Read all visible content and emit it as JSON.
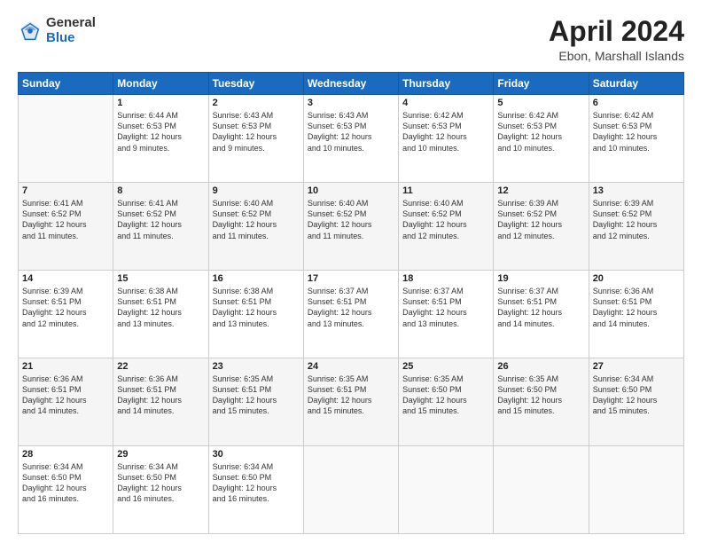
{
  "header": {
    "logo_general": "General",
    "logo_blue": "Blue",
    "month_year": "April 2024",
    "location": "Ebon, Marshall Islands"
  },
  "days_of_week": [
    "Sunday",
    "Monday",
    "Tuesday",
    "Wednesday",
    "Thursday",
    "Friday",
    "Saturday"
  ],
  "weeks": [
    [
      {
        "day": "",
        "sunrise": "",
        "sunset": "",
        "daylight": ""
      },
      {
        "day": "1",
        "sunrise": "6:44 AM",
        "sunset": "6:53 PM",
        "daylight": "12 hours and 9 minutes."
      },
      {
        "day": "2",
        "sunrise": "6:43 AM",
        "sunset": "6:53 PM",
        "daylight": "12 hours and 9 minutes."
      },
      {
        "day": "3",
        "sunrise": "6:43 AM",
        "sunset": "6:53 PM",
        "daylight": "12 hours and 10 minutes."
      },
      {
        "day": "4",
        "sunrise": "6:42 AM",
        "sunset": "6:53 PM",
        "daylight": "12 hours and 10 minutes."
      },
      {
        "day": "5",
        "sunrise": "6:42 AM",
        "sunset": "6:53 PM",
        "daylight": "12 hours and 10 minutes."
      },
      {
        "day": "6",
        "sunrise": "6:42 AM",
        "sunset": "6:53 PM",
        "daylight": "12 hours and 10 minutes."
      }
    ],
    [
      {
        "day": "7",
        "sunrise": "6:41 AM",
        "sunset": "6:52 PM",
        "daylight": "12 hours and 11 minutes."
      },
      {
        "day": "8",
        "sunrise": "6:41 AM",
        "sunset": "6:52 PM",
        "daylight": "12 hours and 11 minutes."
      },
      {
        "day": "9",
        "sunrise": "6:40 AM",
        "sunset": "6:52 PM",
        "daylight": "12 hours and 11 minutes."
      },
      {
        "day": "10",
        "sunrise": "6:40 AM",
        "sunset": "6:52 PM",
        "daylight": "12 hours and 11 minutes."
      },
      {
        "day": "11",
        "sunrise": "6:40 AM",
        "sunset": "6:52 PM",
        "daylight": "12 hours and 12 minutes."
      },
      {
        "day": "12",
        "sunrise": "6:39 AM",
        "sunset": "6:52 PM",
        "daylight": "12 hours and 12 minutes."
      },
      {
        "day": "13",
        "sunrise": "6:39 AM",
        "sunset": "6:52 PM",
        "daylight": "12 hours and 12 minutes."
      }
    ],
    [
      {
        "day": "14",
        "sunrise": "6:39 AM",
        "sunset": "6:51 PM",
        "daylight": "12 hours and 12 minutes."
      },
      {
        "day": "15",
        "sunrise": "6:38 AM",
        "sunset": "6:51 PM",
        "daylight": "12 hours and 13 minutes."
      },
      {
        "day": "16",
        "sunrise": "6:38 AM",
        "sunset": "6:51 PM",
        "daylight": "12 hours and 13 minutes."
      },
      {
        "day": "17",
        "sunrise": "6:37 AM",
        "sunset": "6:51 PM",
        "daylight": "12 hours and 13 minutes."
      },
      {
        "day": "18",
        "sunrise": "6:37 AM",
        "sunset": "6:51 PM",
        "daylight": "12 hours and 13 minutes."
      },
      {
        "day": "19",
        "sunrise": "6:37 AM",
        "sunset": "6:51 PM",
        "daylight": "12 hours and 14 minutes."
      },
      {
        "day": "20",
        "sunrise": "6:36 AM",
        "sunset": "6:51 PM",
        "daylight": "12 hours and 14 minutes."
      }
    ],
    [
      {
        "day": "21",
        "sunrise": "6:36 AM",
        "sunset": "6:51 PM",
        "daylight": "12 hours and 14 minutes."
      },
      {
        "day": "22",
        "sunrise": "6:36 AM",
        "sunset": "6:51 PM",
        "daylight": "12 hours and 14 minutes."
      },
      {
        "day": "23",
        "sunrise": "6:35 AM",
        "sunset": "6:51 PM",
        "daylight": "12 hours and 15 minutes."
      },
      {
        "day": "24",
        "sunrise": "6:35 AM",
        "sunset": "6:51 PM",
        "daylight": "12 hours and 15 minutes."
      },
      {
        "day": "25",
        "sunrise": "6:35 AM",
        "sunset": "6:50 PM",
        "daylight": "12 hours and 15 minutes."
      },
      {
        "day": "26",
        "sunrise": "6:35 AM",
        "sunset": "6:50 PM",
        "daylight": "12 hours and 15 minutes."
      },
      {
        "day": "27",
        "sunrise": "6:34 AM",
        "sunset": "6:50 PM",
        "daylight": "12 hours and 15 minutes."
      }
    ],
    [
      {
        "day": "28",
        "sunrise": "6:34 AM",
        "sunset": "6:50 PM",
        "daylight": "12 hours and 16 minutes."
      },
      {
        "day": "29",
        "sunrise": "6:34 AM",
        "sunset": "6:50 PM",
        "daylight": "12 hours and 16 minutes."
      },
      {
        "day": "30",
        "sunrise": "6:34 AM",
        "sunset": "6:50 PM",
        "daylight": "12 hours and 16 minutes."
      },
      {
        "day": "",
        "sunrise": "",
        "sunset": "",
        "daylight": ""
      },
      {
        "day": "",
        "sunrise": "",
        "sunset": "",
        "daylight": ""
      },
      {
        "day": "",
        "sunrise": "",
        "sunset": "",
        "daylight": ""
      },
      {
        "day": "",
        "sunrise": "",
        "sunset": "",
        "daylight": ""
      }
    ]
  ]
}
